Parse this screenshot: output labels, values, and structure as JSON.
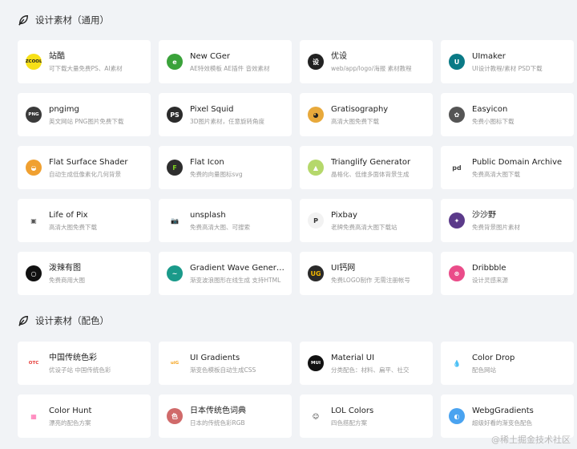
{
  "sections": [
    {
      "title": "设计素材（通用）",
      "cards": [
        {
          "name": "站酷",
          "desc": "可下载大量免费PS、AI素材",
          "icon": "zcool-logo-icon",
          "bg": "#f7e017",
          "fg": "#222",
          "glyph": "ZCOOL"
        },
        {
          "name": "New CGer",
          "desc": "AE特效模板 AE插件 音效素材",
          "icon": "newcger-logo-icon",
          "bg": "#3aa23a",
          "fg": "#fff",
          "glyph": "e"
        },
        {
          "name": "优设",
          "desc": "web/app/logo/海报 素材教程",
          "icon": "uisdc-logo-icon",
          "bg": "#222222",
          "fg": "#fff",
          "glyph": "设"
        },
        {
          "name": "UImaker",
          "desc": "UI设计教程/素材 PSD下载",
          "icon": "uimaker-logo-icon",
          "bg": "#0a7a86",
          "fg": "#fff",
          "glyph": "U"
        },
        {
          "name": "pngimg",
          "desc": "英文网站 PNG图片免费下载",
          "icon": "pngimg-logo-icon",
          "bg": "#3a3a3a",
          "fg": "#fff",
          "glyph": "PNG"
        },
        {
          "name": "Pixel Squid",
          "desc": "3D图片素材，任意旋转角度",
          "icon": "pixelsquid-logo-icon",
          "bg": "#2b2b2b",
          "fg": "#fff",
          "glyph": "PS"
        },
        {
          "name": "Gratisography",
          "desc": "高清大图免费下载",
          "icon": "gratisography-logo-icon",
          "bg": "#e8a93b",
          "fg": "#222",
          "glyph": "◕"
        },
        {
          "name": "Easyicon",
          "desc": "免费小图标下载",
          "icon": "easyicon-logo-icon",
          "bg": "#555555",
          "fg": "#fff",
          "glyph": "✿"
        },
        {
          "name": "Flat Surface Shader",
          "desc": "自动生成低像素化几何背景",
          "icon": "fss-logo-icon",
          "bg": "#f0a030",
          "fg": "#fff",
          "glyph": "◒"
        },
        {
          "name": "Flat Icon",
          "desc": "免费的向量图标svg",
          "icon": "flaticon-logo-icon",
          "bg": "#2e2e2e",
          "fg": "#7ed321",
          "glyph": "F"
        },
        {
          "name": "Trianglify Generator",
          "desc": "晶格化、低维多面体背景生成",
          "icon": "trianglify-logo-icon",
          "bg": "#b5d86b",
          "fg": "#fff",
          "glyph": "▲"
        },
        {
          "name": "Public Domain Archive",
          "desc": "免费高清大图下载",
          "icon": "pdarchive-logo-icon",
          "bg": "#ffffff",
          "fg": "#444",
          "glyph": "pd"
        },
        {
          "name": "Life of Pix",
          "desc": "高清大图免费下载",
          "icon": "lifeofpix-logo-icon",
          "bg": "#ffffff",
          "fg": "#555",
          "glyph": "▣"
        },
        {
          "name": "unsplash",
          "desc": "免费高清大图、可搜索",
          "icon": "unsplash-camera-icon",
          "bg": "#ffffff",
          "fg": "#111",
          "glyph": "📷"
        },
        {
          "name": "Pixbay",
          "desc": "老牌免费高清大图下载站",
          "icon": "pixabay-logo-icon",
          "bg": "#f2f2f2",
          "fg": "#333",
          "glyph": "P"
        },
        {
          "name": "沙沙野",
          "desc": "免费背景图片素材",
          "icon": "ssyer-logo-icon",
          "bg": "#5b3a8a",
          "fg": "#fff",
          "glyph": "✦"
        },
        {
          "name": "泼辣有图",
          "desc": "免费商用大图",
          "icon": "polayoutu-logo-icon",
          "bg": "#111111",
          "fg": "#fff",
          "glyph": "○"
        },
        {
          "name": "Gradient Wave Generator",
          "desc": "渐变波浪图形在线生成 支持HTML",
          "icon": "gradient-wave-logo-icon",
          "bg": "#1a9a8a",
          "fg": "#fff",
          "glyph": "~"
        },
        {
          "name": "UI钙网",
          "desc": "免费LOGO制作 无需注册帐号",
          "icon": "uugai-logo-icon",
          "bg": "#2a2a2a",
          "fg": "#f5b800",
          "glyph": "UG"
        },
        {
          "name": "Dribbble",
          "desc": "设计灵感来源",
          "icon": "dribbble-logo-icon",
          "bg": "#ea4c89",
          "fg": "#fff",
          "glyph": "⊛"
        }
      ]
    },
    {
      "title": "设计素材（配色）",
      "cards": [
        {
          "name": "中国传统色彩",
          "desc": "优设子站 中国传统色彩",
          "icon": "otc-logo-icon",
          "bg": "#ffffff",
          "fg": "#e53935",
          "glyph": "OTC"
        },
        {
          "name": "UI Gradients",
          "desc": "渐变色模板自动生成CSS",
          "icon": "uigradients-logo-icon",
          "bg": "#ffffff",
          "fg": "#f5a623",
          "glyph": "uiG"
        },
        {
          "name": "Material UI",
          "desc": "分类配色：材料、扁平、社交",
          "icon": "materialui-logo-icon",
          "bg": "#111111",
          "fg": "#fff",
          "glyph": "MUI"
        },
        {
          "name": "Color Drop",
          "desc": "配色网站",
          "icon": "colordrop-logo-icon",
          "bg": "#ffffff",
          "fg": "#e23",
          "glyph": "💧"
        },
        {
          "name": "Color Hunt",
          "desc": "漂亮的配色方案",
          "icon": "colorhunt-logo-icon",
          "bg": "#ffffff",
          "fg": "#f6a",
          "glyph": "▦"
        },
        {
          "name": "日本传统色词典",
          "desc": "日本的传统色彩RGB",
          "icon": "nipponcolors-logo-icon",
          "bg": "#d06a6a",
          "fg": "#fff",
          "glyph": "色"
        },
        {
          "name": "LOL Colors",
          "desc": "四色搭配方案",
          "icon": "lolcolors-logo-icon",
          "bg": "#ffffff",
          "fg": "#333",
          "glyph": "☺"
        },
        {
          "name": "WebgGradients",
          "desc": "超级好看的渐变色配色",
          "icon": "webgradients-logo-icon",
          "bg": "#4aa3f0",
          "fg": "#fff",
          "glyph": "◐"
        }
      ]
    }
  ],
  "watermark": "@稀土掘金技术社区"
}
